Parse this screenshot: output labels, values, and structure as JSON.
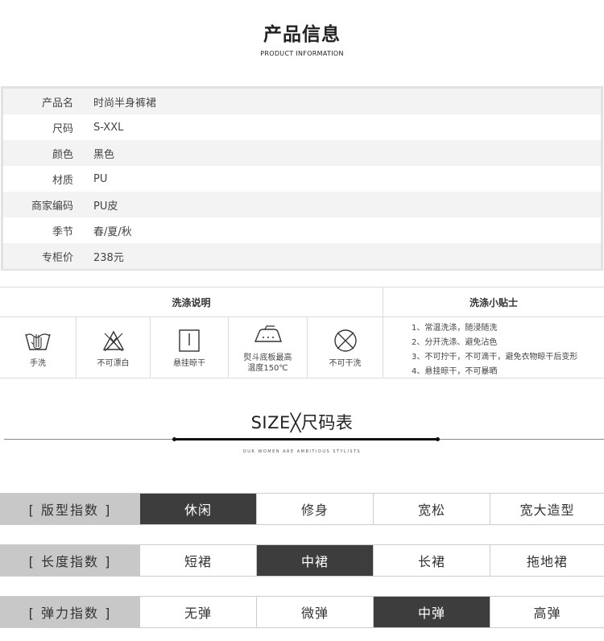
{
  "header": {
    "title": "产品信息",
    "subtitle": "PRODUCT INFORMATION"
  },
  "product": {
    "rows": [
      {
        "key": "产品名",
        "value": "时尚半身裤裙"
      },
      {
        "key": "尺码",
        "value": "S-XXL"
      },
      {
        "key": "颜色",
        "value": "黑色"
      },
      {
        "key": "材质",
        "value": "PU"
      },
      {
        "key": "商家编码",
        "value": "PU皮"
      },
      {
        "key": "季节",
        "value": "春/夏/秋"
      },
      {
        "key": "专柜价",
        "value": "238元"
      }
    ]
  },
  "wash": {
    "heading_left": "洗涤说明",
    "heading_right": "洗涤小贴士",
    "icons": [
      {
        "icon": "hand-wash-icon",
        "label": "手洗"
      },
      {
        "icon": "no-bleach-icon",
        "label": "不可漂白"
      },
      {
        "icon": "hang-dry-icon",
        "label": "悬挂晾干"
      },
      {
        "icon": "iron-icon",
        "label_line1": "熨斗底板最高",
        "label_line2": "温度150℃"
      },
      {
        "icon": "no-dry-clean-icon",
        "label": "不可干洗"
      }
    ],
    "tips": [
      "1、常温洗涤，随浸随洗",
      "2、分开洗涤、避免沾色",
      "3、不可拧干，不可滴干，避免衣物晾干后变形",
      "4、悬挂晾干，不可暴晒"
    ]
  },
  "size": {
    "title": "SIZE╳尺码表",
    "subtitle": "OUR WOMEN ARE AMBITIOUS STYLISTS"
  },
  "indices": [
    {
      "label": "[ 版型指数 ]",
      "options": [
        "休闲",
        "修身",
        "宽松",
        "宽大造型"
      ],
      "selected": 0
    },
    {
      "label": "[ 长度指数 ]",
      "options": [
        "短裙",
        "中裙",
        "长裙",
        "拖地裙"
      ],
      "selected": 1
    },
    {
      "label": "[ 弹力指数 ]",
      "options": [
        "无弹",
        "微弹",
        "中弹",
        "高弹"
      ],
      "selected": 2
    }
  ]
}
